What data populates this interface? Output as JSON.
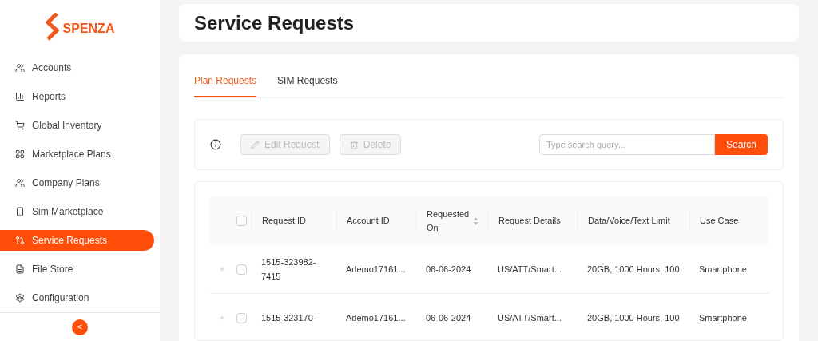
{
  "brand": {
    "name": "SPENZA"
  },
  "sidebar": {
    "items": [
      {
        "label": "Accounts",
        "selected": false
      },
      {
        "label": "Reports",
        "selected": false
      },
      {
        "label": "Global Inventory",
        "selected": false
      },
      {
        "label": "Marketplace Plans",
        "selected": false
      },
      {
        "label": "Company Plans",
        "selected": false
      },
      {
        "label": "Sim Marketplace",
        "selected": false
      },
      {
        "label": "Service Requests",
        "selected": true
      },
      {
        "label": "File Store",
        "selected": false
      },
      {
        "label": "Configuration",
        "selected": false
      }
    ],
    "collapse": {
      "icon": "<"
    }
  },
  "page": {
    "title": "Service Requests"
  },
  "tabs": [
    {
      "label": "Plan Requests",
      "selected": true
    },
    {
      "label": "SIM Requests",
      "selected": false
    }
  ],
  "toolbar": {
    "edit": {
      "label": "Edit Request",
      "disabled": true
    },
    "delete": {
      "label": "Delete",
      "disabled": true
    },
    "search": {
      "placeholder": "Type search query...",
      "button": "Search"
    }
  },
  "table": {
    "checked": false,
    "columns": [
      {
        "label": "Request ID",
        "sortable": false
      },
      {
        "label": "Account ID",
        "sortable": false
      },
      {
        "label": "Requested On",
        "sortable": true
      },
      {
        "label": "Request Details",
        "sortable": false
      },
      {
        "label": "Data/Voice/Text Limit",
        "sortable": false
      },
      {
        "label": "Use Case",
        "sortable": false
      }
    ],
    "rows": [
      {
        "cells": [
          "1515-323982-7415",
          "Ademo17161...",
          "06-06-2024",
          "US/ATT/Smart...",
          "20GB, 1000 Hours, 100",
          "Smartphone"
        ],
        "checked": false
      },
      {
        "cells": [
          "1515-323170-",
          "Ademo17161...",
          "06-06-2024",
          "US/ATT/Smart...",
          "20GB, 1000 Hours, 100",
          "Smartphone"
        ],
        "checked": false
      }
    ]
  }
}
